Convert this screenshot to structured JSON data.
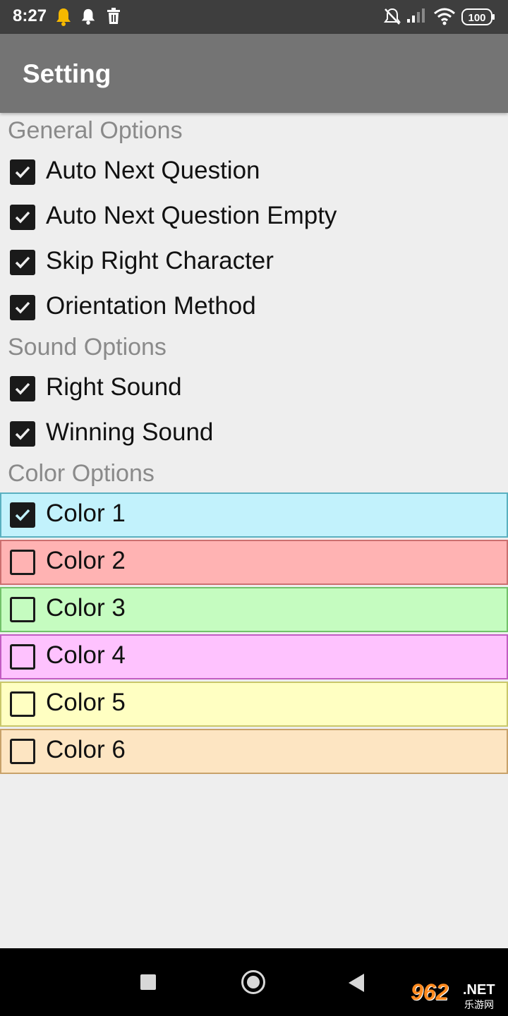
{
  "status_bar": {
    "time": "8:27",
    "battery": "100",
    "left_icons": [
      "bell-yellow-icon",
      "bell-icon",
      "trash-icon"
    ],
    "right_icons": [
      "mute-icon",
      "signal-icon",
      "wifi-icon",
      "battery-icon"
    ]
  },
  "app_bar": {
    "title": "Setting"
  },
  "sections": {
    "general": {
      "title": "General Options",
      "items": [
        {
          "label": "Auto Next Question",
          "checked": true
        },
        {
          "label": "Auto Next Question Empty",
          "checked": true
        },
        {
          "label": "Skip Right Character",
          "checked": true
        },
        {
          "label": "Orientation Method",
          "checked": true
        }
      ]
    },
    "sound": {
      "title": "Sound Options",
      "items": [
        {
          "label": "Right Sound",
          "checked": true
        },
        {
          "label": "Winning Sound",
          "checked": true
        }
      ]
    },
    "color": {
      "title": "Color Options",
      "items": [
        {
          "label": "Color 1",
          "checked": true,
          "bg": "#c2f2fc",
          "border": "#5ab0c0"
        },
        {
          "label": "Color 2",
          "checked": false,
          "bg": "#ffb3b3",
          "border": "#cc6f6f"
        },
        {
          "label": "Color 3",
          "checked": false,
          "bg": "#c5fcc0",
          "border": "#72c26a"
        },
        {
          "label": "Color 4",
          "checked": false,
          "bg": "#fec2fe",
          "border": "#c25cc2"
        },
        {
          "label": "Color 5",
          "checked": false,
          "bg": "#ffffc2",
          "border": "#c9c76a"
        },
        {
          "label": "Color 6",
          "checked": false,
          "bg": "#fde5c2",
          "border": "#c8a26a"
        }
      ]
    }
  },
  "nav_bar": {
    "icons": [
      "recents-icon",
      "home-icon",
      "back-icon"
    ]
  },
  "watermark": {
    "number": "962",
    "net": ".NET",
    "cn": "乐游网"
  }
}
